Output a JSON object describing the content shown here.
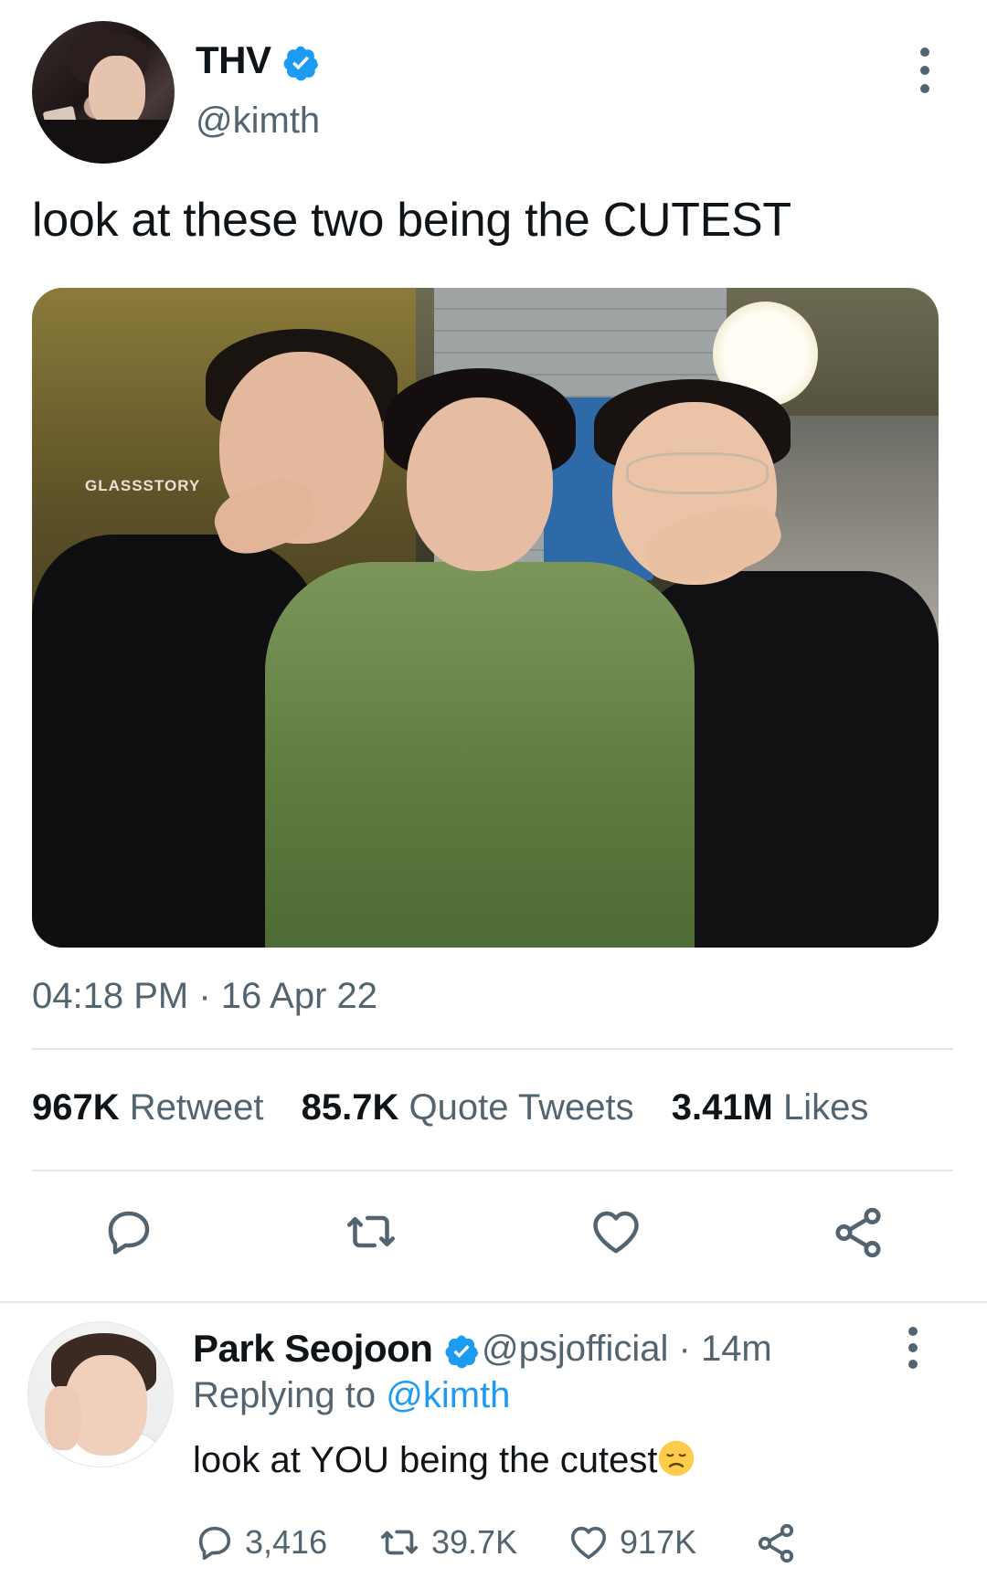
{
  "tweet": {
    "display_name": "THV",
    "handle": "@kimth",
    "text": "look at these two being the CUTEST",
    "timestamp": "04:18 PM · 16 Apr 22",
    "stats": {
      "retweets_count": "967K",
      "retweets_label": "Retweet",
      "quotes_count": "85.7K",
      "quotes_label": "Quote Tweets",
      "likes_count": "3.41M",
      "likes_label": "Likes"
    },
    "photo_sign_text": "GLASSSTORY"
  },
  "reply": {
    "display_name": "Park Seojoon",
    "meta": "@psjofficial · 14m",
    "replying_prefix": "Replying to",
    "replying_handle": "@kimth",
    "text": "look at YOU being the cutest",
    "emoji": "disappointed-face",
    "counts": {
      "replies": "3,416",
      "retweets": "39.7K",
      "likes": "917K"
    }
  },
  "colors": {
    "verified_blue": "#1d9bf0",
    "secondary_text": "#536471",
    "primary_text": "#0f1419",
    "divider": "#e5e8eb"
  },
  "icons": [
    "more-vertical-icon",
    "reply-icon",
    "retweet-icon",
    "like-icon",
    "share-icon",
    "verified-badge-icon"
  ]
}
